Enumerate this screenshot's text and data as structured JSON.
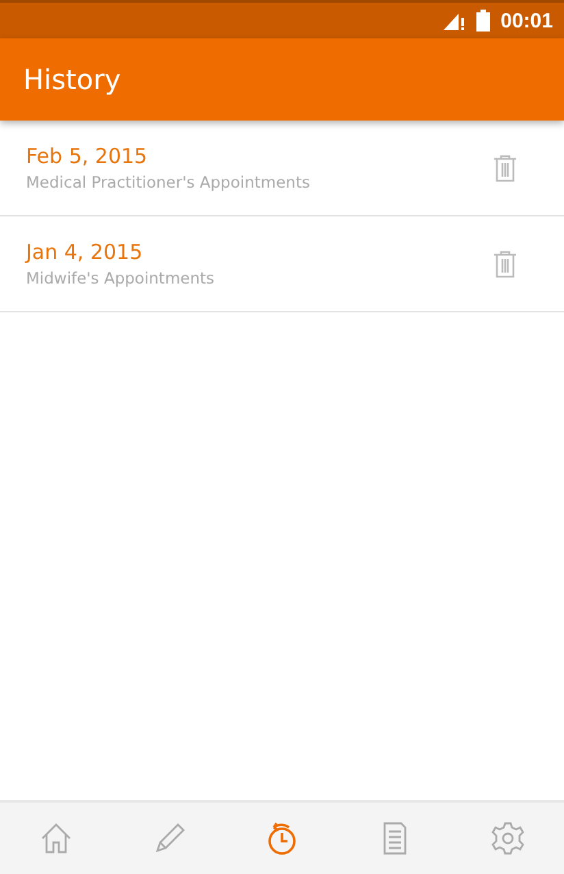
{
  "status_bar": {
    "time": "00:01"
  },
  "app_bar": {
    "title": "History"
  },
  "entries": [
    {
      "date": "Feb 5, 2015",
      "subtitle": "Medical Practitioner's Appointments"
    },
    {
      "date": "Jan 4, 2015",
      "subtitle": "Midwife's Appointments"
    }
  ],
  "nav": [
    {
      "kind": "home",
      "selected": false
    },
    {
      "kind": "edit",
      "selected": false
    },
    {
      "kind": "history",
      "selected": true
    },
    {
      "kind": "document",
      "selected": false
    },
    {
      "kind": "settings",
      "selected": false
    }
  ]
}
